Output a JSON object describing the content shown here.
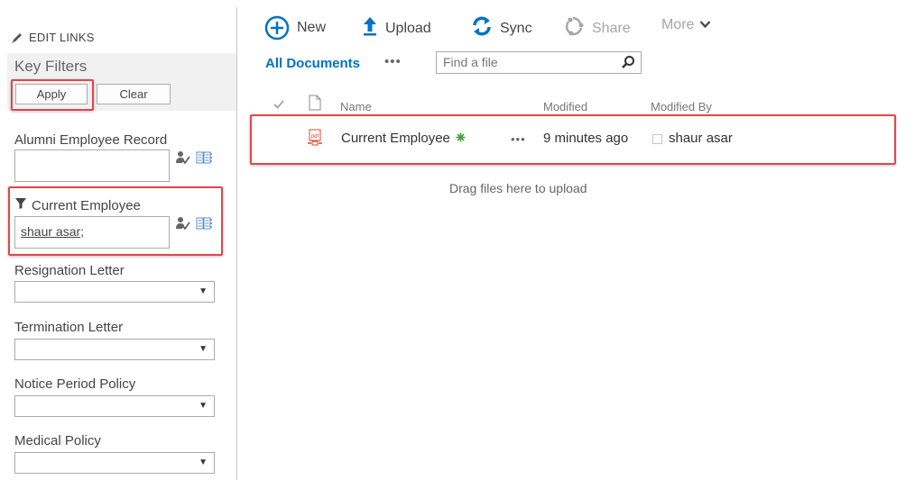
{
  "sidebar": {
    "edit_links_label": "EDIT LINKS",
    "key_filters": {
      "title": "Key Filters",
      "apply_label": "Apply",
      "clear_label": "Clear"
    },
    "filters": [
      {
        "label": "Alumni Employee Record",
        "type": "people-picker",
        "value": ""
      },
      {
        "label": "Current Employee",
        "type": "people-picker",
        "value": "shaur asar;",
        "active": true
      },
      {
        "label": "Resignation Letter",
        "type": "dropdown",
        "value": ""
      },
      {
        "label": "Termination Letter",
        "type": "dropdown",
        "value": ""
      },
      {
        "label": "Notice Period Policy",
        "type": "dropdown",
        "value": ""
      },
      {
        "label": "Medical Policy",
        "type": "dropdown",
        "value": ""
      }
    ],
    "dropdown_arrow": "▼"
  },
  "command_bar": {
    "new_label": "New",
    "upload_label": "Upload",
    "sync_label": "Sync",
    "share_label": "Share",
    "more_label": "More"
  },
  "view": {
    "current_view": "All Documents",
    "ellipsis": "•••",
    "search_placeholder": "Find a file"
  },
  "list": {
    "columns": {
      "name": "Name",
      "modified": "Modified",
      "modified_by": "Modified By"
    },
    "rows": [
      {
        "type": "pdf",
        "name": "Current Employee",
        "is_new": true,
        "ellipsis": "•••",
        "modified": "9 minutes ago",
        "modified_by": "shaur asar"
      }
    ],
    "drag_hint": "Drag files here to upload"
  },
  "colors": {
    "accent": "#0072c6",
    "highlight": "#e0474c",
    "pdf": "#d9472b",
    "new_badge": "#4aa03f"
  }
}
